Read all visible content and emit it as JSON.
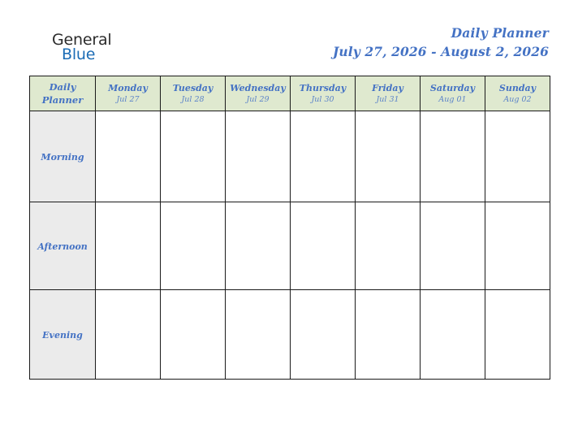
{
  "brand": {
    "word_one": "General",
    "word_two": "Blue",
    "triangle_icon": "triangle-icon",
    "color_dark": "#2b2b2b",
    "color_blue": "#1b6cb5"
  },
  "header": {
    "title": "Daily Planner",
    "date_range": "July 27, 2026 - August 2, 2026",
    "accent_color": "#4472c4"
  },
  "table": {
    "corner": {
      "line1": "Daily",
      "line2": "Planner"
    },
    "header_background": "#dfe9cf",
    "label_background": "#ebebeb",
    "border_color": "#1a1a1a",
    "columns": [
      {
        "day": "Monday",
        "date": "Jul 27"
      },
      {
        "day": "Tuesday",
        "date": "Jul 28"
      },
      {
        "day": "Wednesday",
        "date": "Jul 29"
      },
      {
        "day": "Thursday",
        "date": "Jul 30"
      },
      {
        "day": "Friday",
        "date": "Jul 31"
      },
      {
        "day": "Saturday",
        "date": "Aug 01"
      },
      {
        "day": "Sunday",
        "date": "Aug 02"
      }
    ],
    "rows": [
      {
        "label": "Morning",
        "cells": [
          "",
          "",
          "",
          "",
          "",
          "",
          ""
        ]
      },
      {
        "label": "Afternoon",
        "cells": [
          "",
          "",
          "",
          "",
          "",
          "",
          ""
        ]
      },
      {
        "label": "Evening",
        "cells": [
          "",
          "",
          "",
          "",
          "",
          "",
          ""
        ]
      }
    ]
  }
}
